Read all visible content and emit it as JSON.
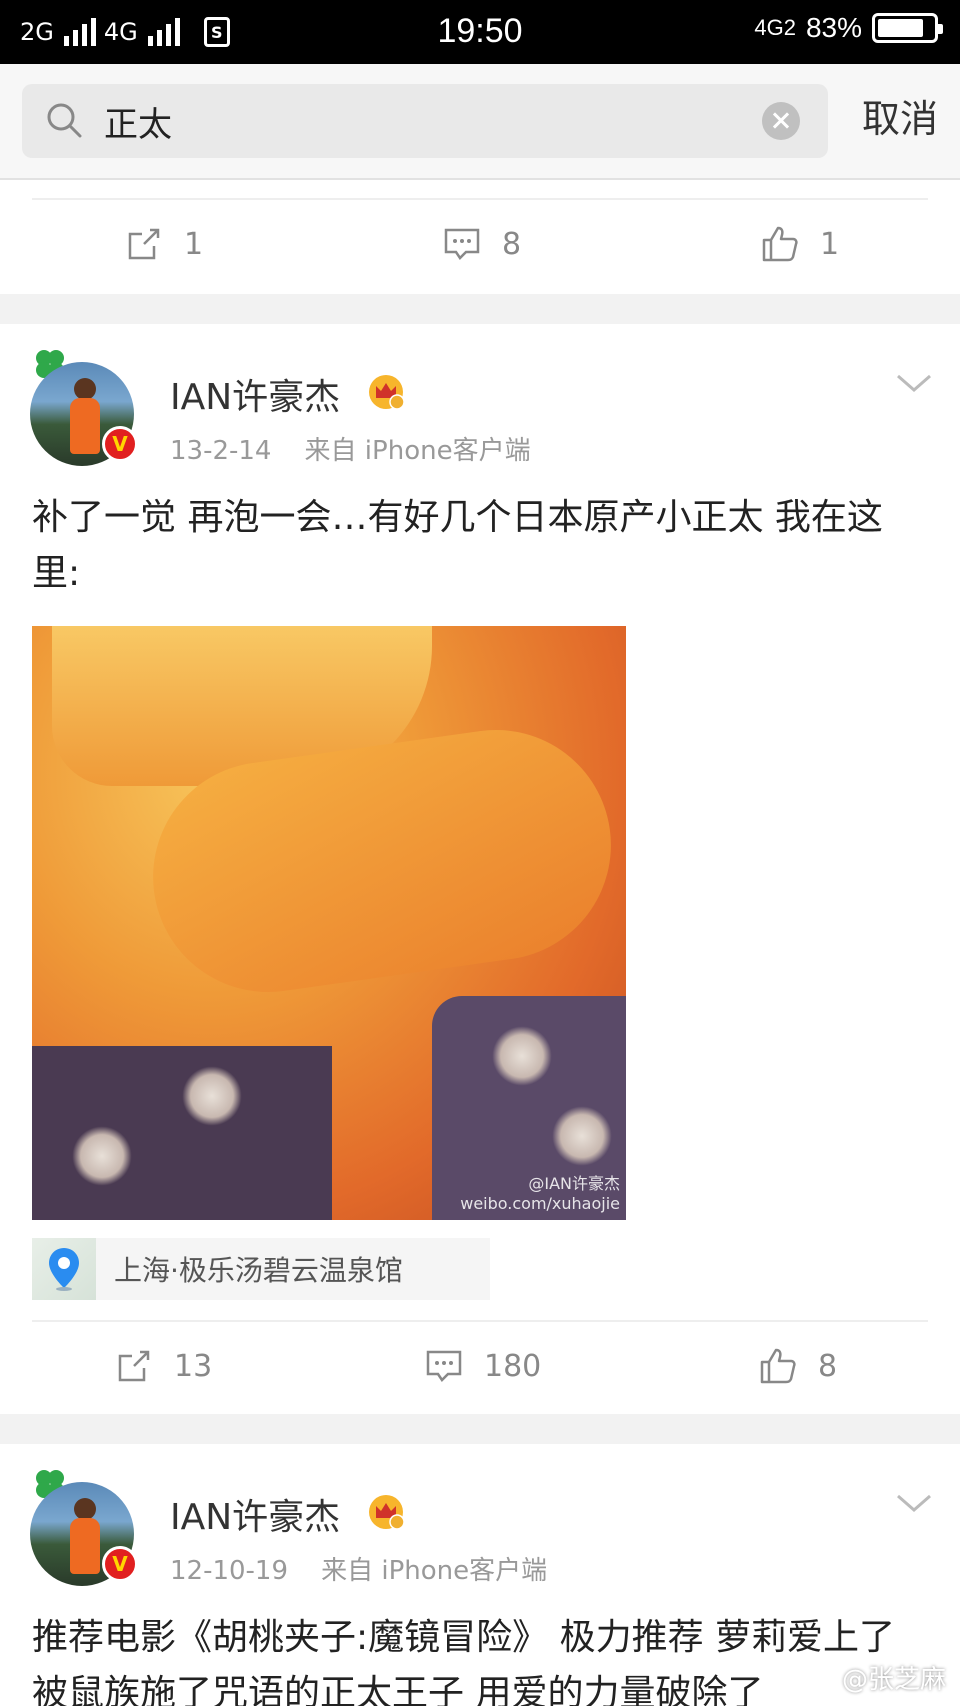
{
  "status_bar": {
    "network_left_1": "2G",
    "network_left_2": "4G",
    "time": "19:50",
    "network_right": "4G2",
    "battery": "83%",
    "battery_level": 0.83
  },
  "search": {
    "query": "正太",
    "cancel_label": "取消"
  },
  "top_actions": {
    "repost_count": "1",
    "comment_count": "8",
    "like_count": "1"
  },
  "posts": [
    {
      "username": "IAN许豪杰",
      "verified_mark": "V",
      "date": "13-2-14",
      "source": "来自 iPhone客户端",
      "text": "补了一觉  再泡一会…有好几个日本原产小正太 我在这里:",
      "image_watermark_1": "@IAN许豪杰",
      "image_watermark_2": "weibo.com/xuhaojie",
      "location": "上海·极乐汤碧云温泉馆",
      "repost_count": "13",
      "comment_count": "180",
      "like_count": "8"
    },
    {
      "username": "IAN许豪杰",
      "verified_mark": "V",
      "date": "12-10-19",
      "source": "来自 iPhone客户端",
      "text": "推荐电影《胡桃夹子:魔镜冒险》 极力推荐 萝莉爱上了被鼠族施了咒语的正太王子 用爱的力量破除了"
    }
  ],
  "corner_watermark": "@张芝麻",
  "colors": {
    "status_bar_bg": "#000000",
    "verified_red": "#e12020",
    "muted_text": "#999999",
    "separator_band": "#f2f2f2"
  }
}
